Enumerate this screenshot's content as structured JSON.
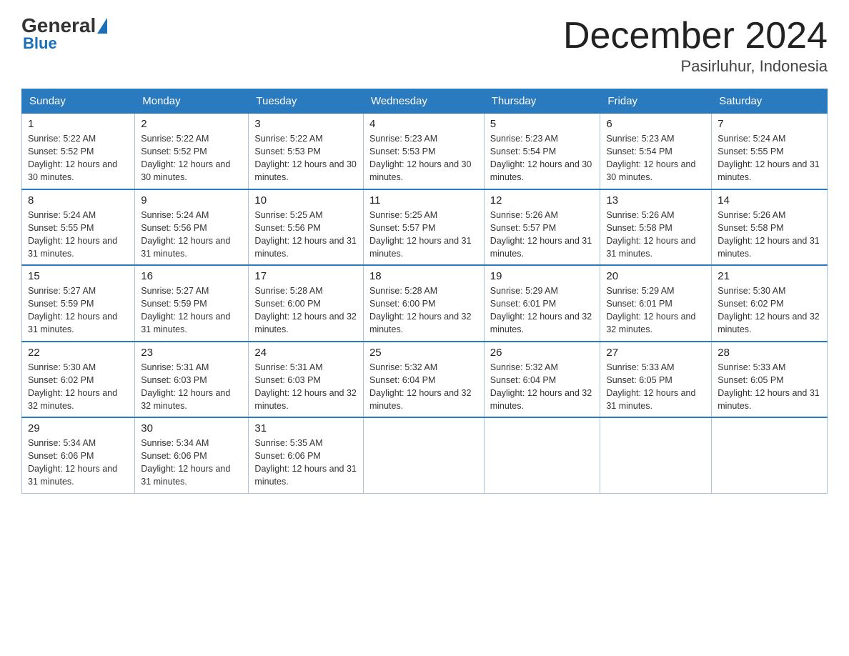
{
  "header": {
    "logo_general": "General",
    "logo_blue": "Blue",
    "title": "December 2024",
    "subtitle": "Pasirluhur, Indonesia"
  },
  "weekdays": [
    "Sunday",
    "Monday",
    "Tuesday",
    "Wednesday",
    "Thursday",
    "Friday",
    "Saturday"
  ],
  "weeks": [
    [
      {
        "day": "1",
        "sunrise": "5:22 AM",
        "sunset": "5:52 PM",
        "daylight": "12 hours and 30 minutes."
      },
      {
        "day": "2",
        "sunrise": "5:22 AM",
        "sunset": "5:52 PM",
        "daylight": "12 hours and 30 minutes."
      },
      {
        "day": "3",
        "sunrise": "5:22 AM",
        "sunset": "5:53 PM",
        "daylight": "12 hours and 30 minutes."
      },
      {
        "day": "4",
        "sunrise": "5:23 AM",
        "sunset": "5:53 PM",
        "daylight": "12 hours and 30 minutes."
      },
      {
        "day": "5",
        "sunrise": "5:23 AM",
        "sunset": "5:54 PM",
        "daylight": "12 hours and 30 minutes."
      },
      {
        "day": "6",
        "sunrise": "5:23 AM",
        "sunset": "5:54 PM",
        "daylight": "12 hours and 30 minutes."
      },
      {
        "day": "7",
        "sunrise": "5:24 AM",
        "sunset": "5:55 PM",
        "daylight": "12 hours and 31 minutes."
      }
    ],
    [
      {
        "day": "8",
        "sunrise": "5:24 AM",
        "sunset": "5:55 PM",
        "daylight": "12 hours and 31 minutes."
      },
      {
        "day": "9",
        "sunrise": "5:24 AM",
        "sunset": "5:56 PM",
        "daylight": "12 hours and 31 minutes."
      },
      {
        "day": "10",
        "sunrise": "5:25 AM",
        "sunset": "5:56 PM",
        "daylight": "12 hours and 31 minutes."
      },
      {
        "day": "11",
        "sunrise": "5:25 AM",
        "sunset": "5:57 PM",
        "daylight": "12 hours and 31 minutes."
      },
      {
        "day": "12",
        "sunrise": "5:26 AM",
        "sunset": "5:57 PM",
        "daylight": "12 hours and 31 minutes."
      },
      {
        "day": "13",
        "sunrise": "5:26 AM",
        "sunset": "5:58 PM",
        "daylight": "12 hours and 31 minutes."
      },
      {
        "day": "14",
        "sunrise": "5:26 AM",
        "sunset": "5:58 PM",
        "daylight": "12 hours and 31 minutes."
      }
    ],
    [
      {
        "day": "15",
        "sunrise": "5:27 AM",
        "sunset": "5:59 PM",
        "daylight": "12 hours and 31 minutes."
      },
      {
        "day": "16",
        "sunrise": "5:27 AM",
        "sunset": "5:59 PM",
        "daylight": "12 hours and 31 minutes."
      },
      {
        "day": "17",
        "sunrise": "5:28 AM",
        "sunset": "6:00 PM",
        "daylight": "12 hours and 32 minutes."
      },
      {
        "day": "18",
        "sunrise": "5:28 AM",
        "sunset": "6:00 PM",
        "daylight": "12 hours and 32 minutes."
      },
      {
        "day": "19",
        "sunrise": "5:29 AM",
        "sunset": "6:01 PM",
        "daylight": "12 hours and 32 minutes."
      },
      {
        "day": "20",
        "sunrise": "5:29 AM",
        "sunset": "6:01 PM",
        "daylight": "12 hours and 32 minutes."
      },
      {
        "day": "21",
        "sunrise": "5:30 AM",
        "sunset": "6:02 PM",
        "daylight": "12 hours and 32 minutes."
      }
    ],
    [
      {
        "day": "22",
        "sunrise": "5:30 AM",
        "sunset": "6:02 PM",
        "daylight": "12 hours and 32 minutes."
      },
      {
        "day": "23",
        "sunrise": "5:31 AM",
        "sunset": "6:03 PM",
        "daylight": "12 hours and 32 minutes."
      },
      {
        "day": "24",
        "sunrise": "5:31 AM",
        "sunset": "6:03 PM",
        "daylight": "12 hours and 32 minutes."
      },
      {
        "day": "25",
        "sunrise": "5:32 AM",
        "sunset": "6:04 PM",
        "daylight": "12 hours and 32 minutes."
      },
      {
        "day": "26",
        "sunrise": "5:32 AM",
        "sunset": "6:04 PM",
        "daylight": "12 hours and 32 minutes."
      },
      {
        "day": "27",
        "sunrise": "5:33 AM",
        "sunset": "6:05 PM",
        "daylight": "12 hours and 31 minutes."
      },
      {
        "day": "28",
        "sunrise": "5:33 AM",
        "sunset": "6:05 PM",
        "daylight": "12 hours and 31 minutes."
      }
    ],
    [
      {
        "day": "29",
        "sunrise": "5:34 AM",
        "sunset": "6:06 PM",
        "daylight": "12 hours and 31 minutes."
      },
      {
        "day": "30",
        "sunrise": "5:34 AM",
        "sunset": "6:06 PM",
        "daylight": "12 hours and 31 minutes."
      },
      {
        "day": "31",
        "sunrise": "5:35 AM",
        "sunset": "6:06 PM",
        "daylight": "12 hours and 31 minutes."
      },
      null,
      null,
      null,
      null
    ]
  ]
}
